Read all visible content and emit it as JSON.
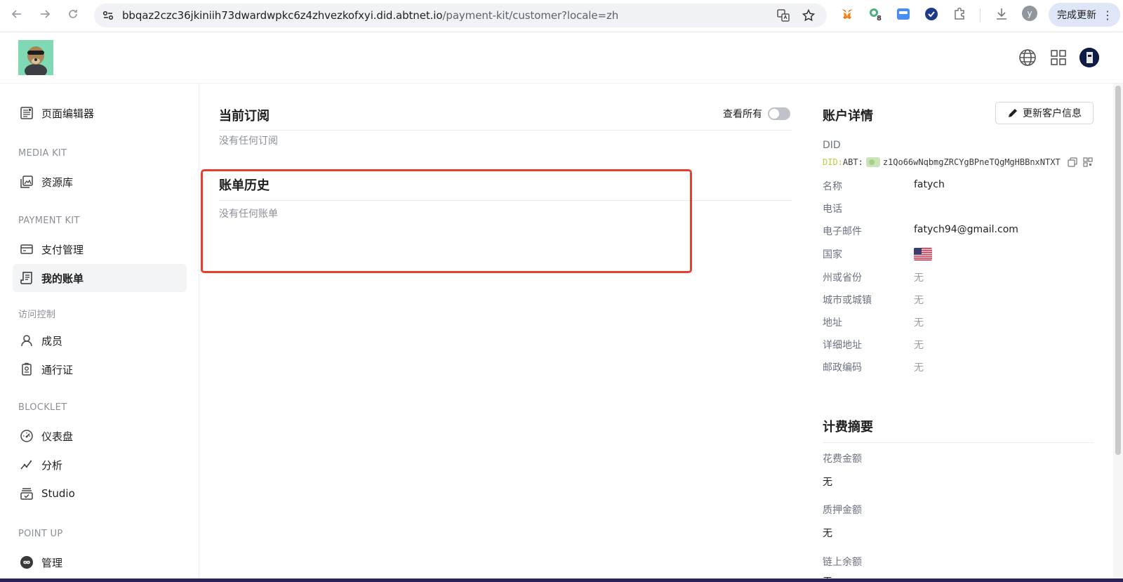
{
  "browser": {
    "url_host": "bbqaz2czc36jkiniih73dwardwpkc6z4zhvezkofxyi.did.abtnet.io",
    "url_path": "/payment-kit/customer?locale=zh",
    "extension_badge": "8",
    "profile_initial": "y",
    "update_label": "完成更新",
    "update_menu": "⋮"
  },
  "sidebar": {
    "page_editor": "页面编辑器",
    "section_media": "MEDIA KIT",
    "assets": "资源库",
    "section_payment": "PAYMENT KIT",
    "payment_mgmt": "支付管理",
    "my_bills": "我的账单",
    "section_access": "访问控制",
    "members": "成员",
    "passport": "通行证",
    "section_blocklet": "BLOCKLET",
    "dashboard": "仪表盘",
    "analytics": "分析",
    "studio": "Studio",
    "section_pointup": "POINT UP",
    "manage": "管理"
  },
  "main": {
    "subscriptions_title": "当前订阅",
    "view_all_label": "查看所有",
    "view_all_on": false,
    "subscriptions_empty": "没有任何订阅",
    "billing_title": "账单历史",
    "billing_empty": "没有任何账单"
  },
  "account": {
    "title": "账户详情",
    "edit_button": "更新客户信息",
    "did_label": "DID",
    "did_prefix": "DID:",
    "did_chain": "ABT:",
    "did_value": "z1Qo66wNqbmgZRCYgBPneTQgMgHBBnxNTXT",
    "name_label": "名称",
    "name_value": "fatych",
    "phone_label": "电话",
    "phone_value": "",
    "email_label": "电子邮件",
    "email_value": "fatych94@gmail.com",
    "country_label": "国家",
    "country_flag": "us-flag",
    "state_label": "州或省份",
    "state_value": "无",
    "city_label": "城市或城镇",
    "city_value": "无",
    "address_label": "地址",
    "address_value": "无",
    "address2_label": "详细地址",
    "address2_value": "无",
    "postal_label": "邮政编码",
    "postal_value": "无"
  },
  "billing_summary": {
    "title": "计费摘要",
    "spent_label": "花费金额",
    "spent_value": "无",
    "staked_label": "质押金额",
    "staked_value": "无",
    "onchain_label": "链上余额",
    "onchain_value": "无"
  },
  "colors": {
    "highlight": "#e4402f",
    "did_prefix": "#c3c93a"
  }
}
